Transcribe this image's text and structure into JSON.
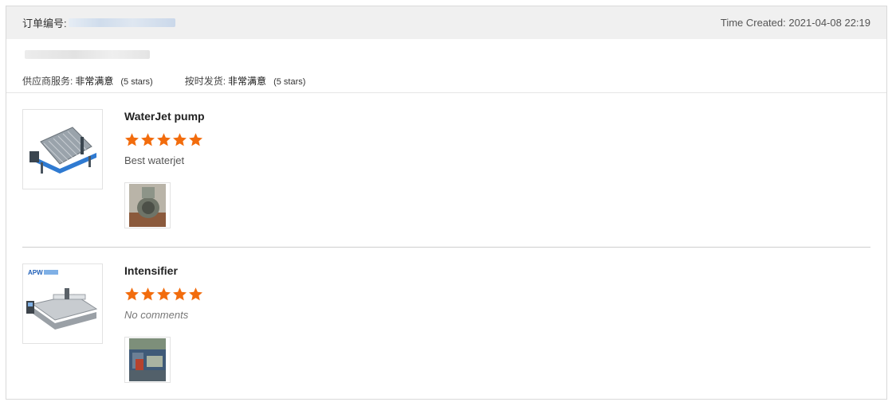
{
  "header": {
    "order_number_label": "订单编号:",
    "time_created": "Time Created: 2021-04-08 22:19"
  },
  "summary": {
    "ratings": [
      {
        "label": "供应商服务:",
        "value": "非常满意",
        "stars_text": "(5 stars)"
      },
      {
        "label": "按时发货:",
        "value": "非常满意",
        "stars_text": "(5 stars)"
      }
    ]
  },
  "products": [
    {
      "name": "WaterJet pump",
      "rating": 5,
      "comment": "Best waterjet",
      "thumbnail_icon": "waterjet-machine-image",
      "photo_icon": "pump-part-photo"
    },
    {
      "name": "Intensifier",
      "rating": 5,
      "comment": "No comments",
      "thumbnail_icon": "apw-waterjet-machine-image",
      "photo_icon": "factory-photo"
    }
  ],
  "colors": {
    "star": "#f26c0d",
    "header_bg": "#f0f0f0",
    "border": "#d9d9d9"
  }
}
